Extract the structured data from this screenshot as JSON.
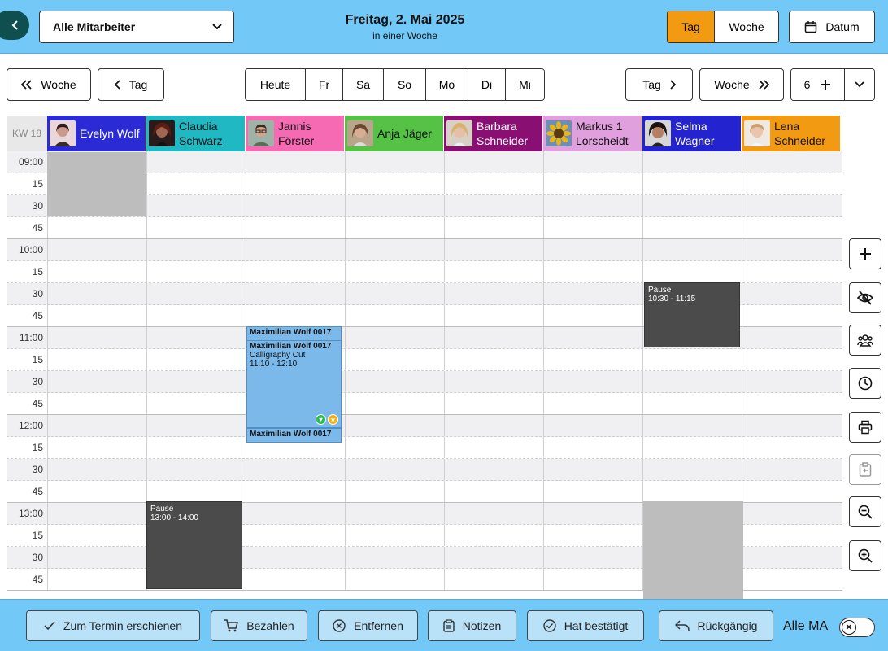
{
  "header": {
    "employee_select": "Alle Mitarbeiter",
    "date_title": "Freitag, 2. Mai 2025",
    "date_subtitle": "in einer Woche",
    "view_tag": "Tag",
    "view_woche": "Woche",
    "datum_label": "Datum",
    "active_view": "Tag"
  },
  "nav": {
    "prev_week": "Woche",
    "prev_day": "Tag",
    "days": [
      "Heute",
      "Fr",
      "Sa",
      "So",
      "Mo",
      "Di",
      "Mi"
    ],
    "next_day": "Tag",
    "next_week": "Woche",
    "column_count": "6"
  },
  "calendar": {
    "week_label": "KW 18",
    "employees": [
      {
        "name": "Evelyn Wolf",
        "color": "#2b2bd6",
        "text_color": "#ffffff"
      },
      {
        "name": "Claudia Schwarz",
        "color": "#20b8c2",
        "text_color": "#111111"
      },
      {
        "name": "Jannis Förster",
        "color": "#f66ab3",
        "text_color": "#111111"
      },
      {
        "name": "Anja Jäger",
        "color": "#55c246",
        "text_color": "#111111"
      },
      {
        "name": "Barbara Schneider",
        "color": "#8a0f73",
        "text_color": "#ffffff"
      },
      {
        "name": "Markus 1 Lorscheidt",
        "color": "#dfa0dd",
        "text_color": "#111111"
      },
      {
        "name": "Selma Wagner",
        "color": "#2323cf",
        "text_color": "#ffffff"
      },
      {
        "name": "Lena Schneider",
        "color": "#f29b12",
        "text_color": "#111111"
      }
    ],
    "times": [
      "09:00",
      "15",
      "30",
      "45",
      "10:00",
      "15",
      "30",
      "45",
      "11:00",
      "15",
      "30",
      "45",
      "12:00",
      "15",
      "30",
      "45",
      "13:00",
      "15",
      "30",
      "45"
    ],
    "pause1": {
      "label": "Pause",
      "time": "10:30 - 11:15"
    },
    "pause2": {
      "label": "Pause",
      "time": "13:00 - 14:00"
    },
    "appointments": [
      {
        "customer": "Maximilian Wolf 0017",
        "service": "",
        "time": ""
      },
      {
        "customer": "Maximilian Wolf 0017",
        "service": "Calligraphy Cut",
        "time": "11:10 - 12:10"
      },
      {
        "customer": "Maximilian Wolf 0017",
        "service": "",
        "time": ""
      }
    ]
  },
  "side_buttons": [
    "plus-icon",
    "eye-off-icon",
    "team-icon",
    "clock-icon",
    "printer-icon",
    "clipboard-icon",
    "zoom-out-icon",
    "zoom-in-icon"
  ],
  "footer": {
    "erschienen": "Zum Termin erschienen",
    "bezahlen": "Bezahlen",
    "entfernen": "Entfernen",
    "notizen": "Notizen",
    "bestaetigt": "Hat bestätigt",
    "rueckgaengig": "Rückgängig",
    "alle_ma": "Alle MA"
  }
}
